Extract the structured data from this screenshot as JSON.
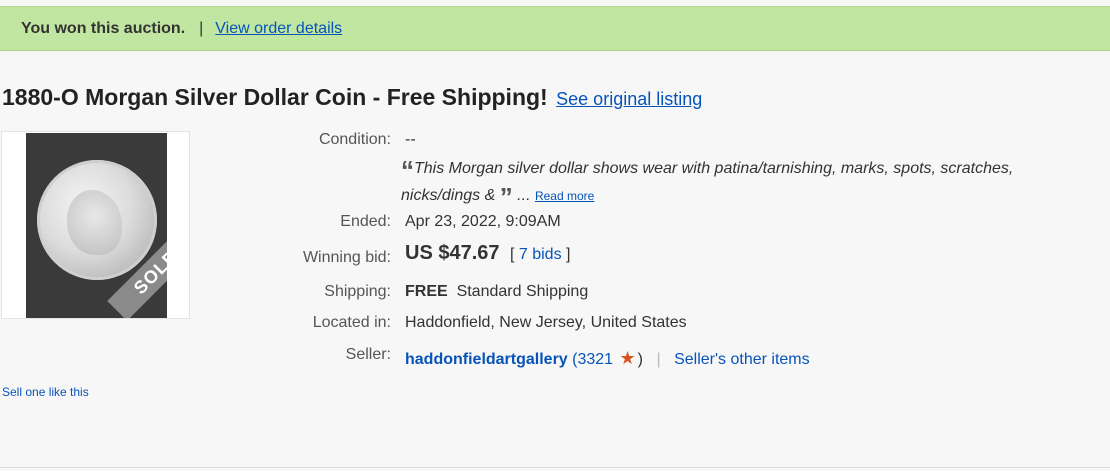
{
  "banner": {
    "status": "You won this auction.",
    "separator": "|",
    "order_link": "View order details"
  },
  "listing": {
    "title": "1880-O Morgan Silver Dollar Coin - Free Shipping!",
    "original_link": "See original listing",
    "image_badge": "SOLD"
  },
  "details": {
    "condition_label": "Condition:",
    "condition_value": "--",
    "description_open": "“",
    "description": "This Morgan silver dollar shows wear with patina/tarnishing, marks, spots, scratches, nicks/dings & ",
    "description_close": "”",
    "ellipsis": "...",
    "read_more": "Read more",
    "ended_label": "Ended:",
    "ended_date": "Apr 23, 2022",
    "ended_time": ", 9:09AM",
    "winning_bid_label": "Winning bid:",
    "winning_bid_value": "US $47.67",
    "bids_open": "[",
    "bids_count": "7 bids",
    "bids_close": "]",
    "shipping_label": "Shipping:",
    "shipping_free": "FREE",
    "shipping_method": "Standard Shipping",
    "location_label": "Located in:",
    "location_value": "Haddonfield, New Jersey, United States",
    "seller_label": "Seller:",
    "seller_name": "haddonfieldartgallery",
    "seller_score_open": "(",
    "seller_score": "3321",
    "seller_score_close": ")",
    "seller_separator": "|",
    "seller_other_items": "Seller's other items"
  },
  "footer": {
    "sell_one": "Sell one like this"
  },
  "colors": {
    "banner_bg": "#c1e6a1",
    "link": "#0654ba",
    "star": "#d9531e",
    "page_bg": "#f7f7f7"
  }
}
